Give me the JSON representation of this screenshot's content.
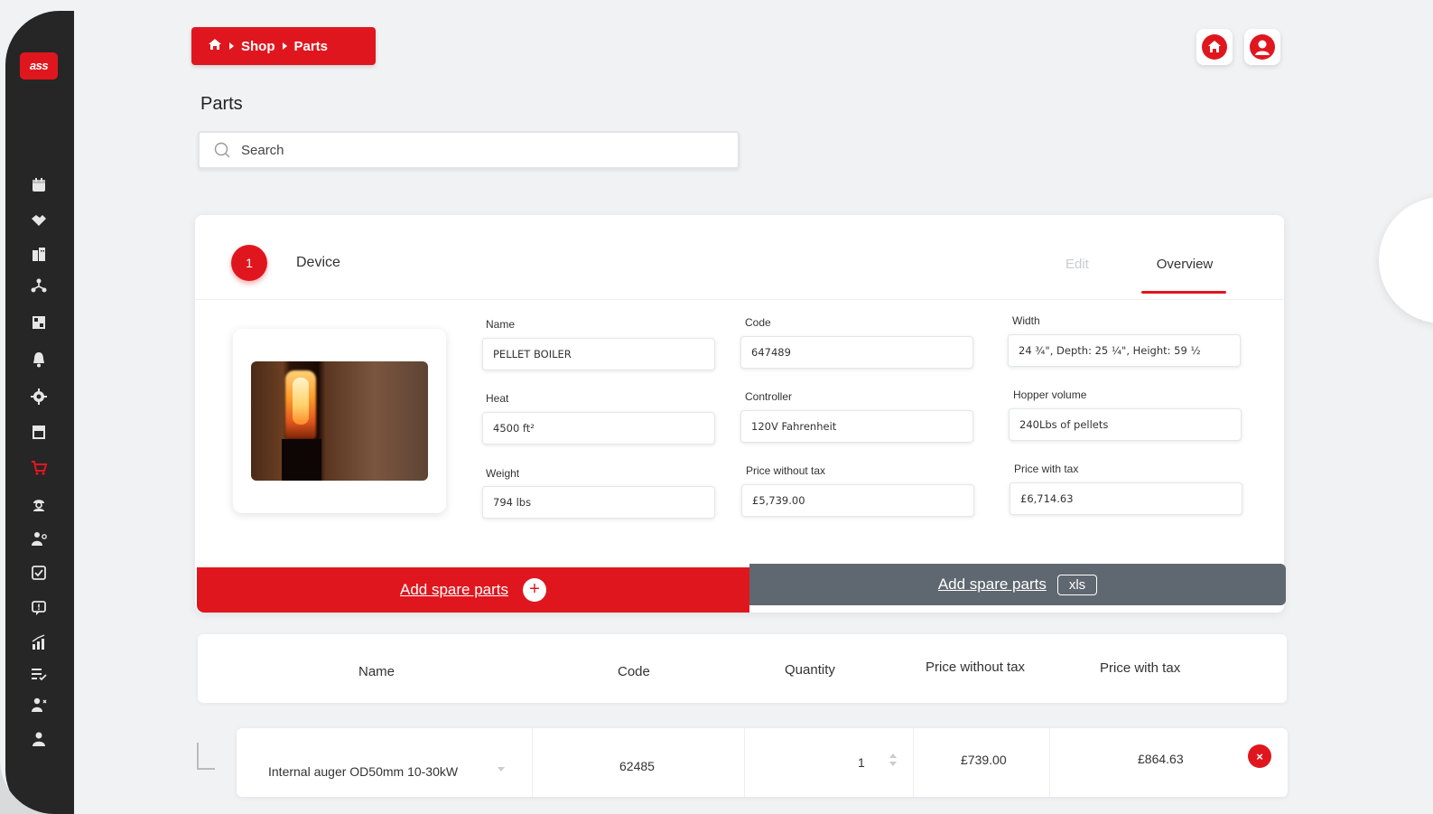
{
  "brand": {
    "logo_text": "ass"
  },
  "breadcrumb": {
    "home_icon": "home-icon",
    "items": [
      "Shop",
      "Parts"
    ]
  },
  "header": {
    "title": "Parts"
  },
  "search": {
    "placeholder": "Search"
  },
  "device": {
    "step": "1",
    "step_label": "Device",
    "tabs": {
      "edit": "Edit",
      "overview": "Overview"
    },
    "fields": {
      "name": {
        "label": "Name",
        "value": "PELLET BOILER"
      },
      "code": {
        "label": "Code",
        "value": "647489"
      },
      "width": {
        "label": "Width",
        "value": "24 ¾\", Depth: 25 ¼\", Height: 59 ½"
      },
      "heat": {
        "label": "Heat",
        "value": "4500 ft²"
      },
      "controller": {
        "label": "Controller",
        "value": "120V Fahrenheit"
      },
      "hopper": {
        "label": "Hopper volume",
        "value": "240Lbs of pellets"
      },
      "weight": {
        "label": "Weight",
        "value": "794 lbs"
      },
      "price_without_tax": {
        "label": "Price without tax",
        "value": "£5,739.00"
      },
      "price_with_tax": {
        "label": "Price with tax",
        "value": "£6,714.63"
      }
    }
  },
  "actions": {
    "add_spare_parts": "Add spare parts",
    "add_spare_parts_xls": "Add spare parts",
    "xls": "xls",
    "plus": "+"
  },
  "table": {
    "headers": [
      "Name",
      "Code",
      "Quantity",
      "Price without tax",
      "Price with tax"
    ],
    "rows": [
      {
        "name": "Internal auger OD50mm 10-30kW",
        "code": "62485",
        "quantity": "1",
        "price_without_tax": "£739.00",
        "price_with_tax": "£864.63",
        "delete": "×"
      }
    ]
  },
  "colors": {
    "accent": "#e0161e",
    "sidebar": "#262626",
    "secondary": "#5f6770"
  }
}
